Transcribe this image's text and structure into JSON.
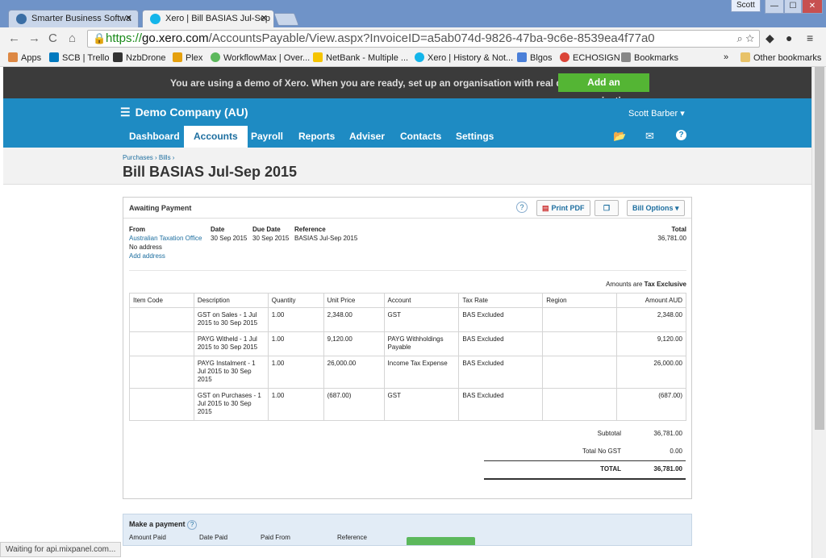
{
  "browser": {
    "tabs": [
      {
        "title": "Smarter Business Softwa",
        "close": "✕"
      },
      {
        "title": "Xero | Bill BASIAS Jul-Sep",
        "close": "✕"
      }
    ],
    "user": "Scott",
    "window_buttons": [
      "—",
      "☐",
      "✕"
    ],
    "url_scheme": "https://",
    "url_host": "go.xero.com",
    "url_path": "/AccountsPayable/View.aspx?InvoiceID=a5ab074d-9826-47ba-9c6e-8539ea4f77a0",
    "bookmarks": [
      {
        "label": "Apps",
        "icon": "apps-grid-icon",
        "color": "#d84"
      },
      {
        "label": "SCB | Trello",
        "icon": "trello-icon",
        "color": "#0079bf"
      },
      {
        "label": "NzbDrone",
        "icon": "nzbdrone-icon",
        "color": "#333"
      },
      {
        "label": "Plex",
        "icon": "plex-icon",
        "color": "#e5a00d"
      },
      {
        "label": "WorkflowMax | Over...",
        "icon": "workflowmax-icon",
        "color": "#5cb85c"
      },
      {
        "label": "NetBank - Multiple ...",
        "icon": "netbank-icon",
        "color": "#f5c400"
      },
      {
        "label": "Xero | History & Not...",
        "icon": "xero-icon",
        "color": "#13b5ea"
      },
      {
        "label": "Blgos",
        "icon": "doc-icon",
        "color": "#4a7fd8"
      },
      {
        "label": "ECHOSIGN",
        "icon": "google-icon",
        "color": "#db4437"
      },
      {
        "label": "Bookmarks",
        "icon": "star-icon",
        "color": "#888"
      }
    ],
    "overflow": "»",
    "other_bookmarks": "Other bookmarks",
    "status": "Waiting for api.mixpanel.com..."
  },
  "demo_bar": {
    "message": "You are using a demo of Xero. When you are ready, set up an organisation with real data.",
    "button": "Add an organisation"
  },
  "header": {
    "org": "Demo Company (AU)",
    "user": "Scott Barber",
    "nav": [
      "Dashboard",
      "Accounts",
      "Payroll",
      "Reports",
      "Adviser",
      "Contacts",
      "Settings"
    ],
    "active_nav": "Accounts"
  },
  "page": {
    "breadcrumb": "Purchases › Bills ›",
    "title": "Bill BASIAS Jul-Sep 2015"
  },
  "bill": {
    "status": "Awaiting Payment",
    "print_pdf": "Print PDF",
    "bill_options": "Bill Options",
    "from_label": "From",
    "from_name": "Australian Taxation Office",
    "no_address": "No address",
    "add_address": "Add address",
    "date_label": "Date",
    "date": "30 Sep 2015",
    "due_label": "Due Date",
    "due": "30 Sep 2015",
    "ref_label": "Reference",
    "ref": "BASIAS Jul-Sep 2015",
    "total_label": "Total",
    "total": "36,781.00",
    "amounts_prefix": "Amounts are",
    "amounts_mode": "Tax Exclusive",
    "columns": [
      "Item Code",
      "Description",
      "Quantity",
      "Unit Price",
      "Account",
      "Tax Rate",
      "Region",
      "Amount AUD"
    ],
    "rows": [
      {
        "code": "",
        "desc": "GST on Sales - 1 Jul 2015 to 30 Sep 2015",
        "qty": "1.00",
        "price": "2,348.00",
        "account": "GST",
        "tax": "BAS Excluded",
        "region": "",
        "amount": "2,348.00"
      },
      {
        "code": "",
        "desc": "PAYG Witheld - 1 Jul 2015 to 30 Sep 2015",
        "qty": "1.00",
        "price": "9,120.00",
        "account": "PAYG Withholdings Payable",
        "tax": "BAS Excluded",
        "region": "",
        "amount": "9,120.00"
      },
      {
        "code": "",
        "desc": "PAYG Instalment - 1 Jul 2015 to 30 Sep 2015",
        "qty": "1.00",
        "price": "26,000.00",
        "account": "Income Tax Expense",
        "tax": "BAS Excluded",
        "region": "",
        "amount": "26,000.00"
      },
      {
        "code": "",
        "desc": "GST on Purchases - 1 Jul 2015 to 30 Sep 2015",
        "qty": "1.00",
        "price": "(687.00)",
        "account": "GST",
        "tax": "BAS Excluded",
        "region": "",
        "amount": "(687.00)"
      }
    ],
    "subtotal_label": "Subtotal",
    "subtotal": "36,781.00",
    "nogst_label": "Total No GST",
    "nogst": "0.00",
    "grand_label": "TOTAL",
    "grand": "36,781.00"
  },
  "payment": {
    "title": "Make a payment",
    "cols": [
      "Amount Paid",
      "Date Paid",
      "Paid From",
      "Reference"
    ]
  },
  "colors": {
    "xero_blue": "#1e8bc3",
    "demo_bar": "#3b3b3b",
    "green": "#54b534"
  }
}
